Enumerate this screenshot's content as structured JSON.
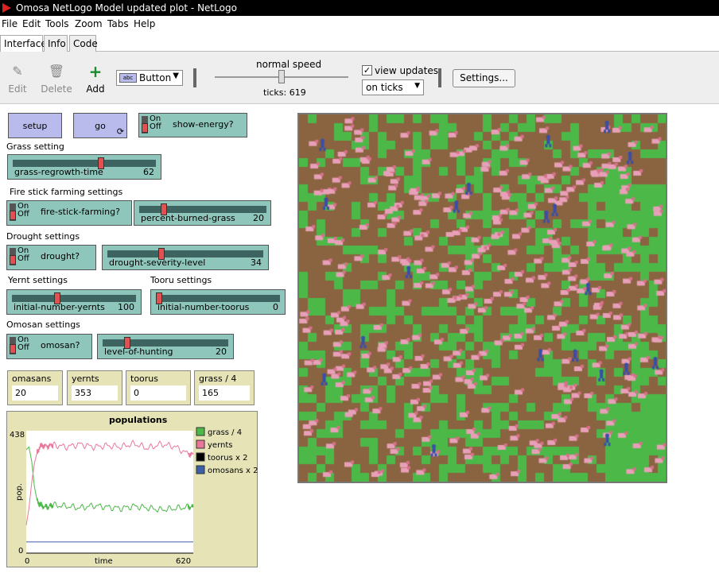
{
  "window": {
    "title": "Omosa NetLogo Model updated plot - NetLogo"
  },
  "menu": [
    "File",
    "Edit",
    "Tools",
    "Zoom",
    "Tabs",
    "Help"
  ],
  "tabs": [
    {
      "label": "Interface",
      "active": true
    },
    {
      "label": "Info"
    },
    {
      "label": "Code"
    }
  ],
  "toolbar": {
    "edit": "Edit",
    "delete": "Delete",
    "add": "Add",
    "widget_select": "Button",
    "speed_label": "normal speed",
    "ticks_label": "ticks: 619",
    "speed_value": 0.5,
    "view_updates_label": "view updates",
    "view_updates_checked": true,
    "update_mode": "on ticks",
    "settings": "Settings..."
  },
  "buttons": {
    "setup": "setup",
    "go": "go"
  },
  "switches": {
    "show_energy": {
      "on": "On",
      "off": "Off",
      "name": "show-energy?"
    },
    "fire_stick": {
      "on": "On",
      "off": "Off",
      "name": "fire-stick-farming?"
    },
    "drought": {
      "on": "On",
      "off": "Off",
      "name": "drought?"
    },
    "omosan": {
      "on": "On",
      "off": "Off",
      "name": "omosan?"
    }
  },
  "sections": {
    "grass": "Grass setting",
    "fire": "Fire stick farming settings",
    "drought": "Drought settings",
    "yernt": "Yernt settings",
    "tooru": "Tooru settings",
    "omosan": "Omosan settings"
  },
  "sliders": {
    "grass_regrowth": {
      "name": "grass-regrowth-time",
      "value": "62",
      "fraction": 0.62
    },
    "percent_burned": {
      "name": "percent-burned-grass",
      "value": "20",
      "fraction": 0.18
    },
    "drought_severity": {
      "name": "drought-severity-level",
      "value": "34",
      "fraction": 0.34
    },
    "yernts": {
      "name": "initial-number-yernts",
      "value": "100",
      "fraction": 0.36
    },
    "toorus": {
      "name": "initial-number-toorus",
      "value": "0",
      "fraction": 0.0
    },
    "hunting": {
      "name": "level-of-hunting",
      "value": "20",
      "fraction": 0.18
    }
  },
  "monitors": [
    {
      "label": "omasans",
      "value": "20"
    },
    {
      "label": "yernts",
      "value": "353"
    },
    {
      "label": "toorus",
      "value": "0"
    },
    {
      "label": "grass / 4",
      "value": "165"
    }
  ],
  "plot": {
    "title": "populations",
    "xlabel": "time",
    "ylabel": "pop.",
    "ymax_label": "438",
    "ymin_label": "0",
    "xmin_label": "0",
    "xmax_label": "620"
  },
  "chart_data": {
    "type": "line",
    "title": "populations",
    "xlabel": "time",
    "ylabel": "pop.",
    "xlim": [
      0,
      620
    ],
    "ylim": [
      0,
      438
    ],
    "legend_position": "right",
    "series": [
      {
        "name": "grass / 4",
        "color": "#4cb848",
        "x": [
          0,
          10,
          20,
          30,
          40,
          50,
          60,
          80,
          100,
          150,
          200,
          250,
          300,
          350,
          400,
          450,
          500,
          550,
          600,
          620
        ],
        "y": [
          370,
          380,
          330,
          240,
          190,
          175,
          168,
          165,
          172,
          168,
          162,
          170,
          165,
          160,
          168,
          162,
          155,
          160,
          165,
          165
        ]
      },
      {
        "name": "yernts",
        "color": "#e8789a",
        "x": [
          0,
          10,
          20,
          30,
          40,
          50,
          60,
          80,
          100,
          150,
          200,
          250,
          300,
          350,
          400,
          450,
          500,
          550,
          600,
          620
        ],
        "y": [
          100,
          160,
          250,
          320,
          360,
          380,
          385,
          382,
          388,
          380,
          390,
          380,
          385,
          380,
          392,
          375,
          390,
          382,
          355,
          353
        ]
      },
      {
        "name": "toorus x 2",
        "color": "#000000",
        "x": [
          0,
          620
        ],
        "y": [
          0,
          0
        ]
      },
      {
        "name": "omosans x 2",
        "color": "#3c5fa8",
        "x": [
          0,
          620
        ],
        "y": [
          40,
          40
        ]
      }
    ]
  },
  "view": {
    "grass_color": "#4cb848",
    "soil_color": "#8a6340",
    "yernt_color": "#e8a0b8",
    "omosan_color": "#3a4ea8"
  }
}
